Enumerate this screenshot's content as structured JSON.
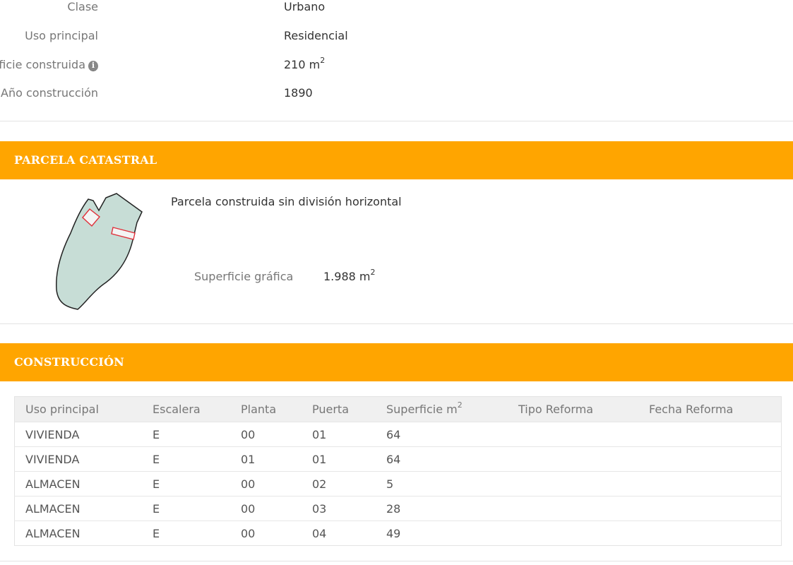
{
  "inmueble": {
    "rows": [
      {
        "label": "Clase",
        "value": "Urbano"
      },
      {
        "label": "Uso principal",
        "value": "Residencial"
      },
      {
        "label": "Superficie construida",
        "value": "210 m",
        "sup": "2",
        "info_icon": "info-icon"
      },
      {
        "label": "Año construcción",
        "value": "1890"
      }
    ]
  },
  "parcela": {
    "title": "PARCELA CATASTRAL",
    "description": "Parcela construida sin división horizontal",
    "superficie_label": "Superficie gráfica",
    "superficie_value": "1.988 m",
    "superficie_sup": "2"
  },
  "construccion": {
    "title": "CONSTRUCCIÓN",
    "columns": [
      "Uso principal",
      "Escalera",
      "Planta",
      "Puerta",
      "Superficie m",
      "Tipo Reforma",
      "Fecha Reforma"
    ],
    "superficie_sup": "2",
    "rows": [
      [
        "VIVIENDA",
        "E",
        "00",
        "01",
        "64",
        "",
        ""
      ],
      [
        "VIVIENDA",
        "E",
        "01",
        "01",
        "64",
        "",
        ""
      ],
      [
        "ALMACEN",
        "E",
        "00",
        "02",
        "5",
        "",
        ""
      ],
      [
        "ALMACEN",
        "E",
        "00",
        "03",
        "28",
        "",
        ""
      ],
      [
        "ALMACEN",
        "E",
        "00",
        "04",
        "49",
        "",
        ""
      ]
    ]
  },
  "colors": {
    "section_header": "#ffa500",
    "parcel_fill": "#c7ddd6",
    "building_outline": "#e0303a"
  }
}
